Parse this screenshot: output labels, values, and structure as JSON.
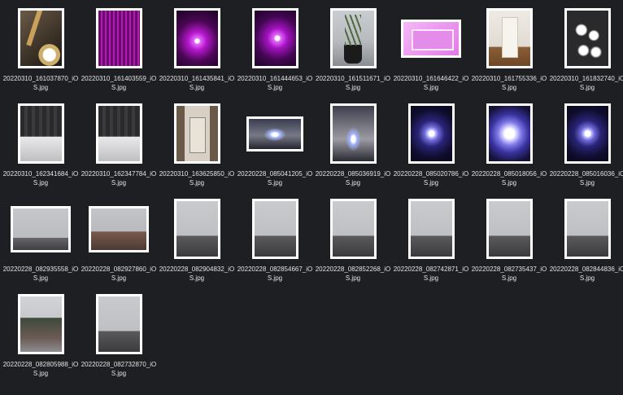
{
  "files": [
    {
      "name": "20220310_161037870_iOS.jpg",
      "picture": "p-lamp",
      "frame": "portrait"
    },
    {
      "name": "20220310_161403559_iOS.jpg",
      "picture": "p-magenta-strip",
      "frame": "portrait"
    },
    {
      "name": "20220310_161435841_iOS.jpg",
      "picture": "p-magenta-glow",
      "frame": "portrait"
    },
    {
      "name": "20220310_161444653_iOS.jpg",
      "picture": "p-magenta-glow2",
      "frame": "portrait"
    },
    {
      "name": "20220310_161511671_iOS.jpg",
      "picture": "p-plant",
      "frame": "portrait"
    },
    {
      "name": "20220310_161646422_iOS.jpg",
      "picture": "p-socket",
      "frame": "land-short"
    },
    {
      "name": "20220310_161755336_iOS.jpg",
      "picture": "p-chair",
      "frame": "portrait"
    },
    {
      "name": "20220310_161832740_iOS.jpg",
      "picture": "p-bulbs",
      "frame": "portrait"
    },
    {
      "name": "20220310_162341684_iOS.jpg",
      "picture": "p-curtain",
      "frame": "portrait"
    },
    {
      "name": "20220310_162347784_iOS.jpg",
      "picture": "p-curtain",
      "frame": "portrait"
    },
    {
      "name": "20220310_163625850_iOS.jpg",
      "picture": "p-room",
      "frame": "portrait"
    },
    {
      "name": "20220228_085041205_iOS.jpg",
      "picture": "p-ceiling",
      "frame": "land-wide"
    },
    {
      "name": "20220228_085036919_iOS.jpg",
      "picture": "p-ceiling2",
      "frame": "portrait"
    },
    {
      "name": "20220228_085020786_iOS.jpg",
      "picture": "p-blue",
      "frame": "portrait"
    },
    {
      "name": "20220228_085018056_iOS.jpg",
      "picture": "p-blue-big",
      "frame": "portrait"
    },
    {
      "name": "20220228_085016036_iOS.jpg",
      "picture": "p-blue",
      "frame": "portrait"
    },
    {
      "name": "20220228_082935558_iOS.jpg",
      "picture": "p-sky-roofs",
      "frame": "landscape"
    },
    {
      "name": "20220228_082927860_iOS.jpg",
      "picture": "p-sky-house",
      "frame": "landscape"
    },
    {
      "name": "20220228_082904832_iOS.jpg",
      "picture": "p-sky",
      "frame": "portrait"
    },
    {
      "name": "20220228_082854667_iOS.jpg",
      "picture": "p-sky",
      "frame": "portrait"
    },
    {
      "name": "20220228_082852268_iOS.jpg",
      "picture": "p-sky",
      "frame": "portrait"
    },
    {
      "name": "20220228_082742871_iOS.jpg",
      "picture": "p-sky",
      "frame": "portrait"
    },
    {
      "name": "20220228_082735437_iOS.jpg",
      "picture": "p-sky",
      "frame": "portrait"
    },
    {
      "name": "20220228_082844836_iOS.jpg",
      "picture": "p-sky",
      "frame": "portrait"
    },
    {
      "name": "20220228_082805988_iOS.jpg",
      "picture": "p-sky-trees",
      "frame": "portrait"
    },
    {
      "name": "20220228_082732870_iOS.jpg",
      "picture": "p-sky",
      "frame": "portrait"
    }
  ]
}
